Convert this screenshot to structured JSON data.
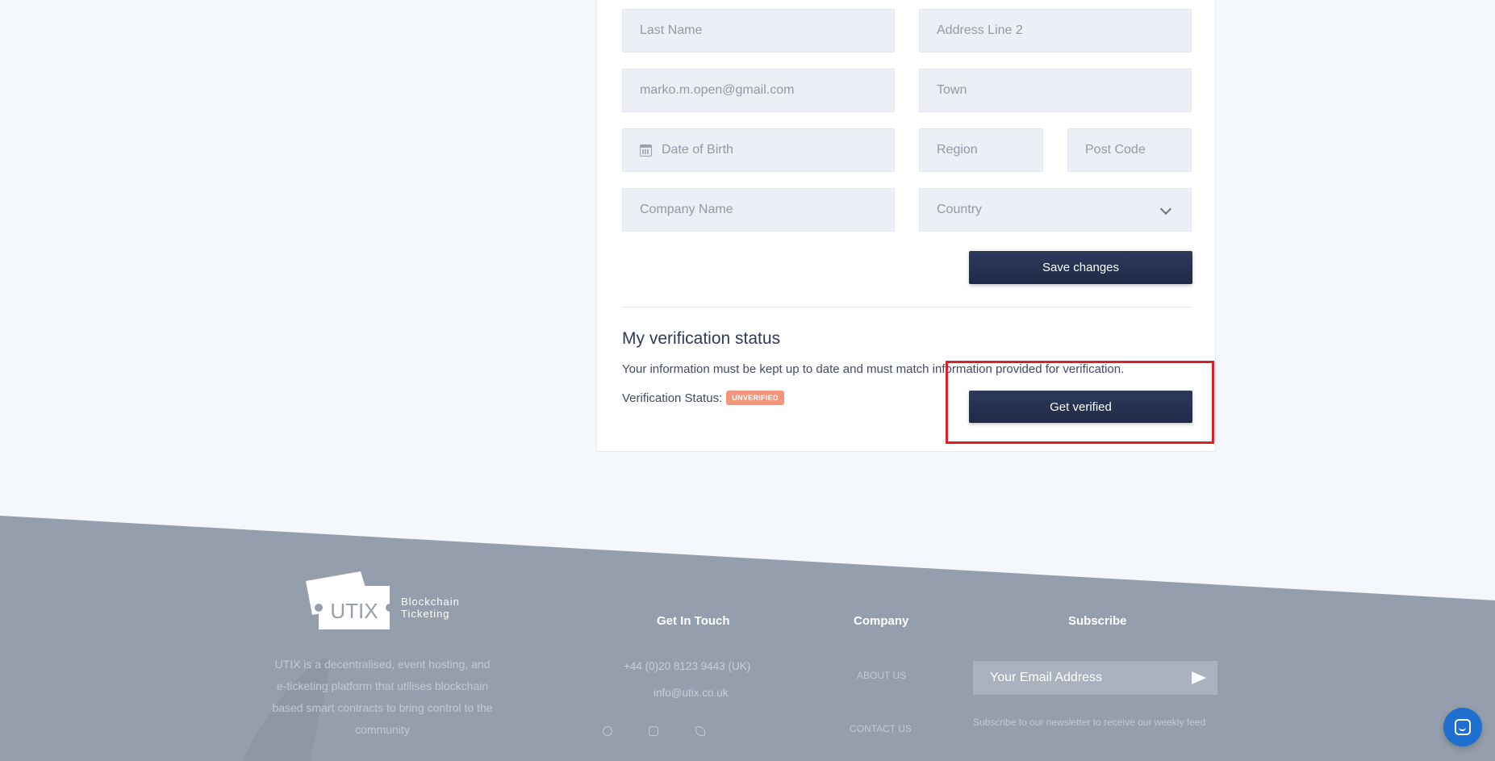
{
  "form": {
    "last_name_placeholder": "Last Name",
    "address2_placeholder": "Address Line 2",
    "email_value": "marko.m.open@gmail.com",
    "town_placeholder": "Town",
    "dob_placeholder": "Date of Birth",
    "region_placeholder": "Region",
    "postcode_placeholder": "Post Code",
    "company_placeholder": "Company Name",
    "country_placeholder": "Country",
    "save_label": "Save changes"
  },
  "verification": {
    "title": "My verification status",
    "description": "Your information must be kept up to date and must match information provided for verification.",
    "status_label": "Verification Status:",
    "status_badge": "UNVERIFIED",
    "get_verified_label": "Get verified"
  },
  "footer": {
    "logo_text": "UTIX",
    "logo_tagline_1": "Blockchain",
    "logo_tagline_2": "Ticketing",
    "about": "UTIX is a decentralised, event hosting, and e-ticketing platform that utilises blockchain based smart contracts to bring control to the community",
    "get_in_touch_heading": "Get In Touch",
    "phone": "+44 (0)20 8123 9443 (UK)",
    "email": "info@utix.co.uk",
    "company_heading": "Company",
    "about_us": "ABOUT US",
    "contact_us": "CONTACT US",
    "subscribe_heading": "Subscribe",
    "subscribe_placeholder": "Your Email Address",
    "subscribe_note": "Subscribe to our newsletter to receive our weekly feed",
    "social_icons": [
      "facebook-icon",
      "instagram-icon",
      "twitter-icon"
    ]
  },
  "colors": {
    "button": "#26324f",
    "badge": "#f2957a",
    "highlight": "#e01e27",
    "footer": "#959eac",
    "chat": "#1f6fd1"
  }
}
